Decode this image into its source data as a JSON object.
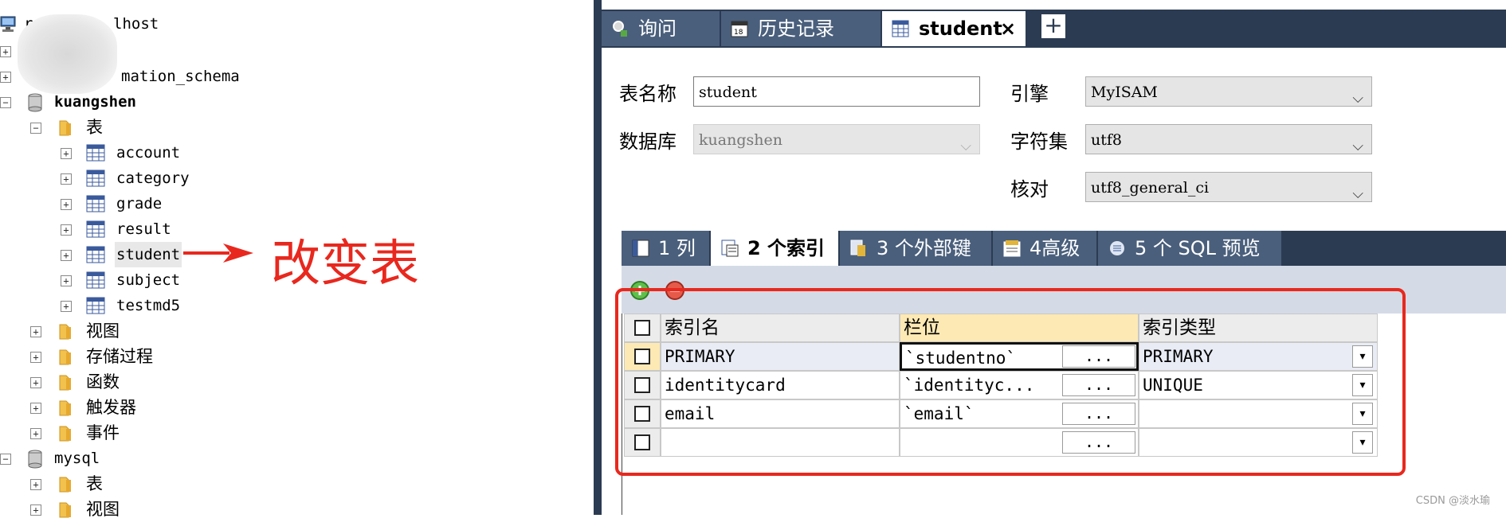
{
  "tree": {
    "server_label": "localhost",
    "server_prefix": "r",
    "items": [
      {
        "label": "information_schema"
      },
      {
        "label": "kuangshen"
      },
      {
        "label": "表"
      },
      {
        "label": "account"
      },
      {
        "label": "category"
      },
      {
        "label": "grade"
      },
      {
        "label": "result"
      },
      {
        "label": "student"
      },
      {
        "label": "subject"
      },
      {
        "label": "testmd5"
      },
      {
        "label": "视图"
      },
      {
        "label": "存储过程"
      },
      {
        "label": "函数"
      },
      {
        "label": "触发器"
      },
      {
        "label": "事件"
      },
      {
        "label": "mysql"
      },
      {
        "label": "表"
      },
      {
        "label": "视图"
      }
    ],
    "visible_fragments": {
      "server_tail": "lhost",
      "schema_tail": "mation_schema"
    }
  },
  "annotation": {
    "text": "改变表",
    "color": "#e8281e"
  },
  "top_tabs": [
    {
      "label": "询问",
      "icon": "query-icon"
    },
    {
      "label": "历史记录",
      "icon": "calendar-icon"
    },
    {
      "label": "student",
      "icon": "table-icon",
      "active": true,
      "close": "×"
    }
  ],
  "plus_tab": "+",
  "form": {
    "table_name_label": "表名称",
    "table_name_value": "student",
    "database_label": "数据库",
    "database_value": "kuangshen",
    "engine_label": "引擎",
    "engine_value": "MyISAM",
    "charset_label": "字符集",
    "charset_value": "utf8",
    "collation_label": "核对",
    "collation_value": "utf8_general_ci"
  },
  "sub_tabs": [
    {
      "label": "1 列",
      "icon": "columns-icon"
    },
    {
      "label": "2 个索引",
      "icon": "index-icon",
      "active": true
    },
    {
      "label": "3 个外部键",
      "icon": "foreign-key-icon"
    },
    {
      "label": "4高级",
      "icon": "advanced-icon"
    },
    {
      "label": "5 个 SQL 预览",
      "icon": "sql-preview-icon"
    }
  ],
  "grid": {
    "headers": [
      "索引名",
      "栏位",
      "索引类型"
    ],
    "rows": [
      {
        "name": "PRIMARY",
        "column": "`studentno`",
        "type": "PRIMARY"
      },
      {
        "name": "identitycard",
        "column": "`identityc...",
        "type": "UNIQUE"
      },
      {
        "name": "email",
        "column": "`email`",
        "type": ""
      },
      {
        "name": "",
        "column": "",
        "type": ""
      }
    ],
    "dots_label": "...",
    "dropdown_glyph": "▾"
  },
  "colors": {
    "accent_dark": "#2b3b52",
    "annotation_red": "#e8281e",
    "header_highlight": "#fde9b4"
  },
  "watermark": "CSDN @淡水瑜"
}
